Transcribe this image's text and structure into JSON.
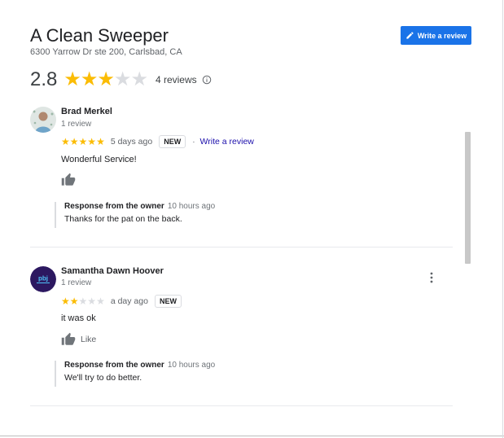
{
  "business": {
    "name": "A Clean Sweeper",
    "address": "6300 Yarrow Dr ste 200, Carlsbad, CA"
  },
  "write_review_button": {
    "label": "Write a review",
    "icon": "pencil-icon"
  },
  "summary": {
    "rating_text": "2.8",
    "rating_value": 2.8,
    "stars": [
      "★",
      "★",
      "★",
      "★",
      "★"
    ],
    "stars_filled": 3,
    "review_count_text": "4 reviews",
    "info_icon": "info-icon"
  },
  "colors": {
    "accent": "#1a73e8",
    "star": "#fbbc04",
    "star_empty": "#dadce0",
    "link": "#1a0dab"
  },
  "reviews": [
    {
      "name": "Brad Merkel",
      "meta": "1 review",
      "stars": [
        "★",
        "★",
        "★",
        "★",
        "★"
      ],
      "rating": 5,
      "time": "5 days ago",
      "badge": "NEW",
      "separator": "·",
      "write_link": "Write a review",
      "text": "Wonderful Service!",
      "like_label": "",
      "owner_response": {
        "title": "Response from the owner",
        "time": "10 hours ago",
        "text": "Thanks for the pat on the back."
      }
    },
    {
      "name": "Samantha Dawn Hoover",
      "meta": "1 review",
      "stars": [
        "★",
        "★",
        "★",
        "★",
        "★"
      ],
      "rating": 2,
      "time": "a day ago",
      "badge": "NEW",
      "text": "it was ok",
      "like_label": "Like",
      "avatar_text": "pbj",
      "owner_response": {
        "title": "Response from the owner",
        "time": "10 hours ago",
        "text": "We'll try to do better."
      }
    }
  ]
}
